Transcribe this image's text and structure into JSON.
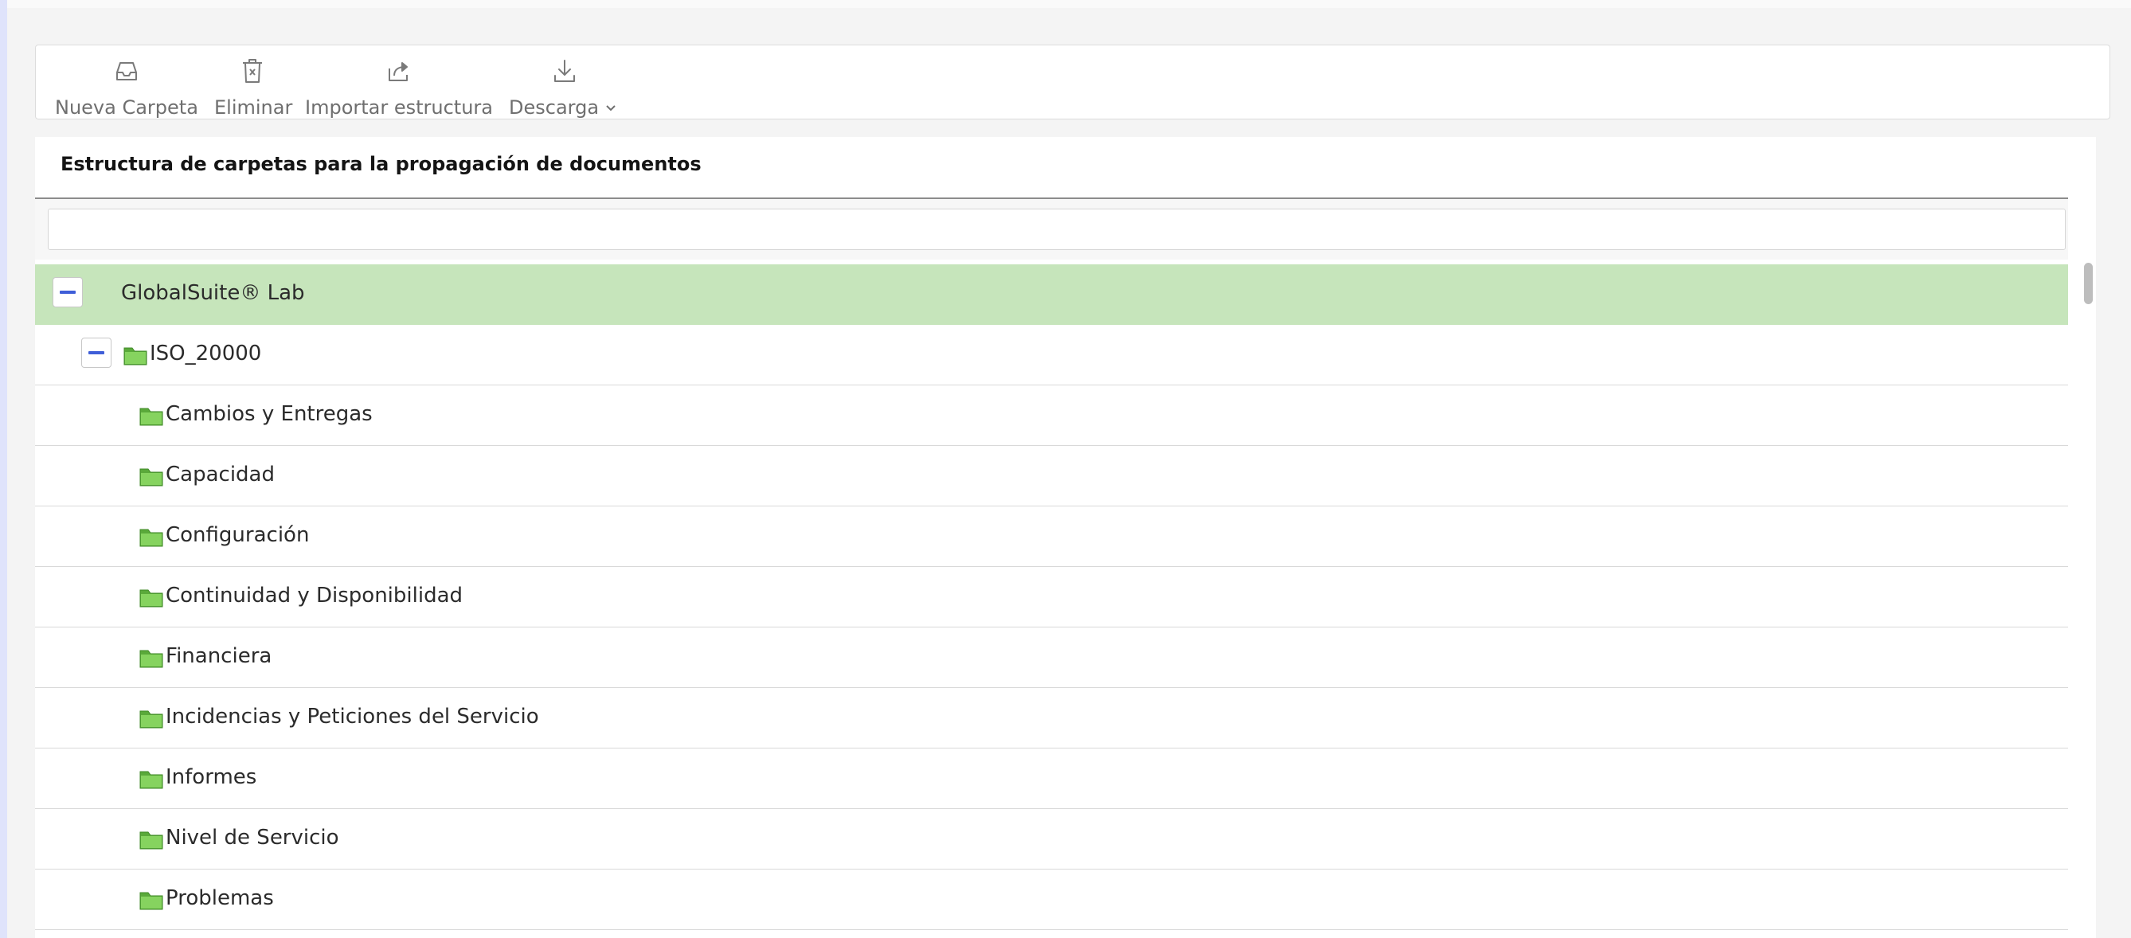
{
  "toolbar": {
    "new_folder": {
      "label": "Nueva Carpeta",
      "icon": "inbox-tray-icon"
    },
    "delete": {
      "label": "Eliminar",
      "icon": "trash-icon"
    },
    "import": {
      "label": "Importar estructura",
      "icon": "share-arrow-icon"
    },
    "download": {
      "label": "Descarga",
      "icon": "download-icon",
      "caret": "chevron-down-icon"
    }
  },
  "panel": {
    "title": "Estructura de carpetas para la propagación de documentos",
    "filter": {
      "value": "",
      "placeholder": ""
    }
  },
  "tree": {
    "root": {
      "label": "GlobalSuite® Lab",
      "expanded": true
    },
    "node": {
      "label": "ISO_20000",
      "expanded": true
    },
    "children": [
      {
        "label": "Cambios y Entregas"
      },
      {
        "label": "Capacidad"
      },
      {
        "label": "Configuración"
      },
      {
        "label": "Continuidad y Disponibilidad"
      },
      {
        "label": "Financiera"
      },
      {
        "label": "Incidencias y Peticiones del Servicio"
      },
      {
        "label": "Informes"
      },
      {
        "label": "Nivel de Servicio"
      },
      {
        "label": "Problemas"
      }
    ]
  },
  "colors": {
    "selected_row": "#c6e5bb",
    "toggle_accent": "#3f5ed8",
    "folder_green": "#6cc04a",
    "left_accent": "#dfe3fb"
  }
}
